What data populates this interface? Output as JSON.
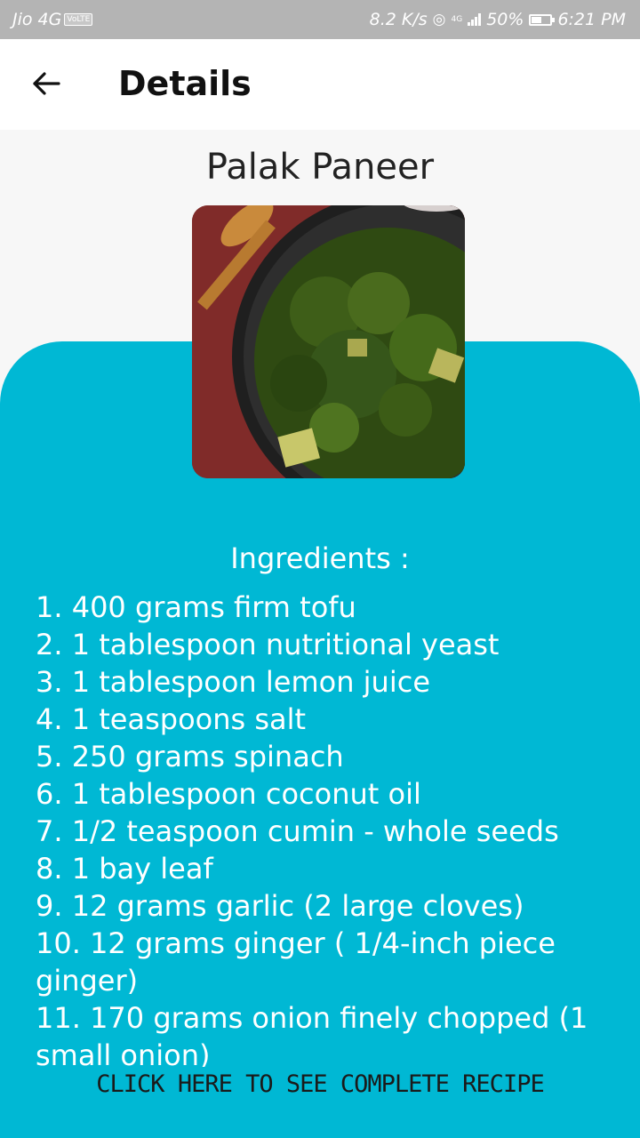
{
  "status_bar": {
    "carrier": "Jio 4G",
    "volte": "VoLTE",
    "speed": "8.2 K/s",
    "network": "4G",
    "battery": "50%",
    "time": "6:21 PM"
  },
  "app_bar": {
    "back_icon": "arrow-left-icon",
    "title": "Details"
  },
  "recipe": {
    "name": "Palak Paneer",
    "image": "palak-paneer-photo"
  },
  "ingredients": {
    "heading": "Ingredients :",
    "items": [
      "1. 400 grams firm tofu",
      "2. 1 tablespoon nutritional yeast",
      "3. 1 tablespoon lemon juice",
      "4. 1 teaspoons salt",
      "5. 250 grams spinach",
      "6. 1 tablespoon coconut oil",
      "7. 1/2 teaspoon cumin - whole seeds",
      "8. 1 bay leaf",
      "9. 12 grams garlic (2 large cloves)",
      "10. 12 grams ginger ( 1/4-inch piece ginger)",
      "11. 170 grams onion finely chopped (1 small onion)"
    ]
  },
  "footer": {
    "link_label": "CLICK HERE TO SEE COMPLETE RECIPE"
  },
  "colors": {
    "accent": "#00b8d4",
    "status_bar": "#b4b4b4",
    "background": "#f7f7f7"
  }
}
